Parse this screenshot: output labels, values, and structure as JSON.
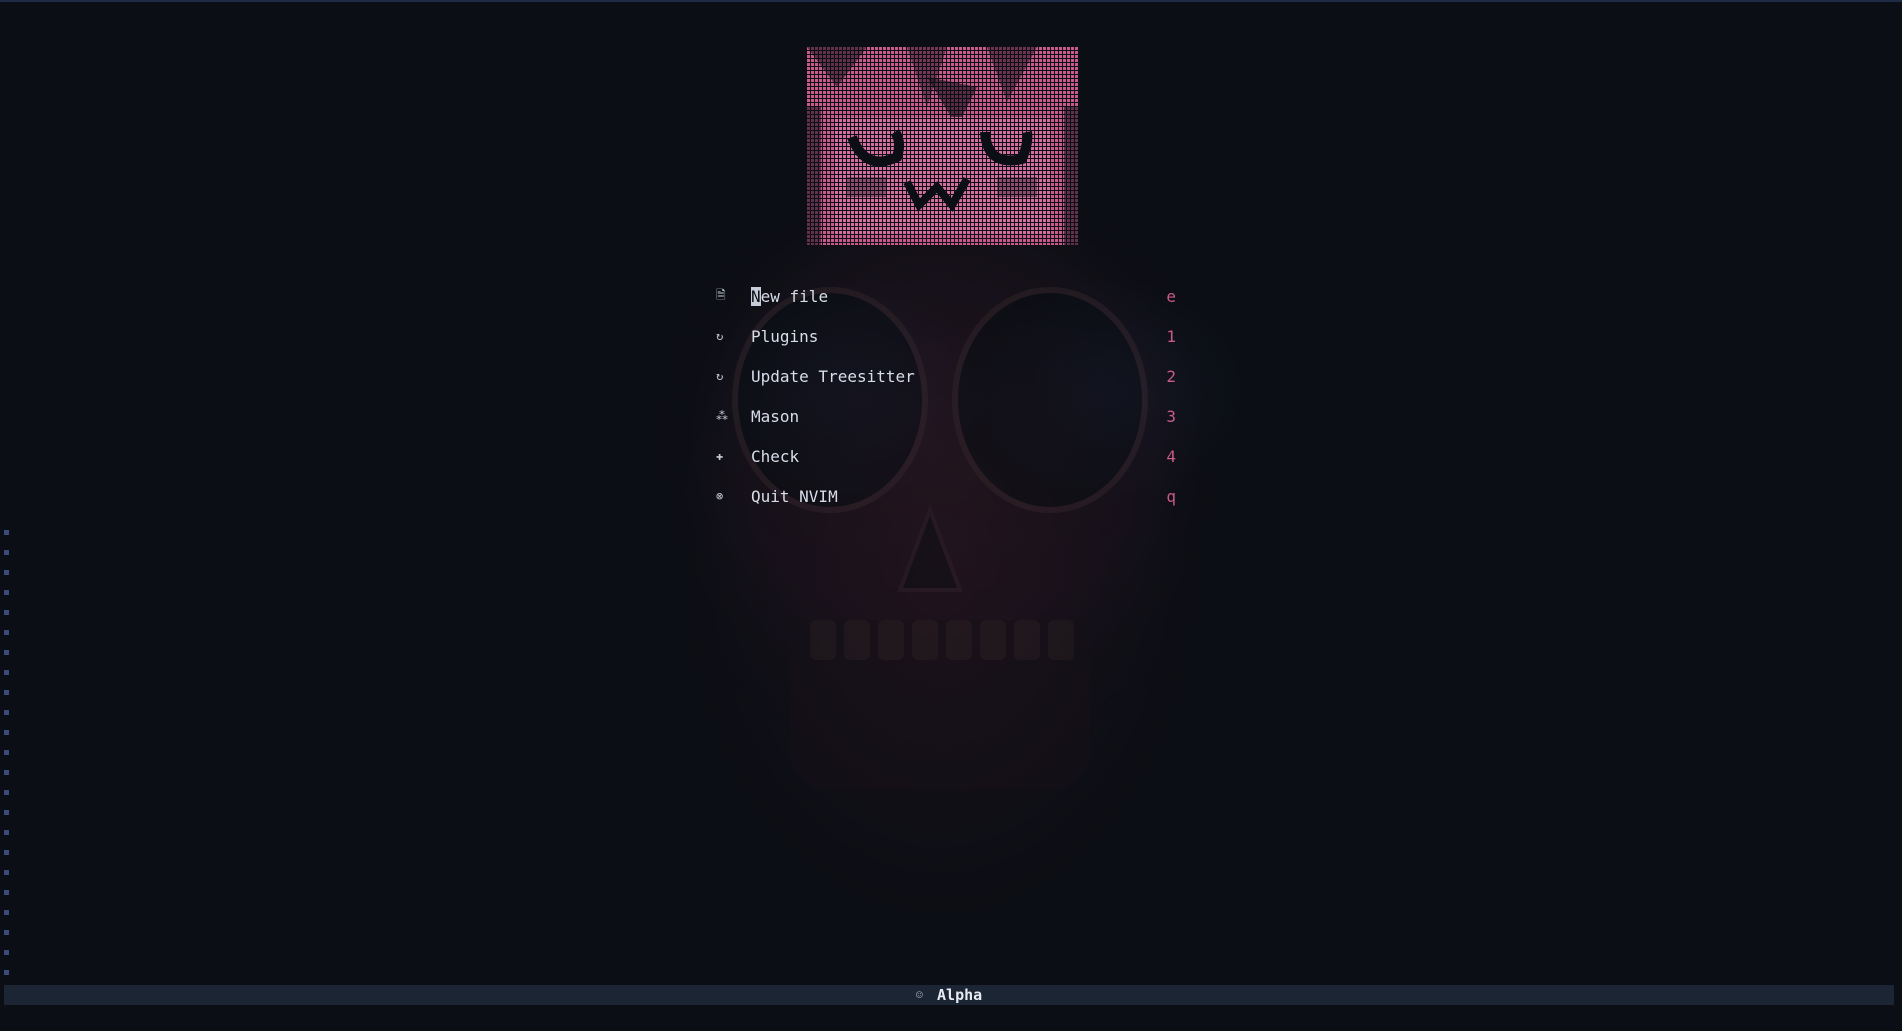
{
  "app": "nvim alpha dashboard",
  "colors": {
    "background": "#0b0e14",
    "accent_pink": "#c95a8c",
    "text": "#d8dee9",
    "statusline": "#1c2533"
  },
  "header_art": {
    "icon": "ascii-art-face-icon"
  },
  "menu": [
    {
      "icon": "file-icon",
      "glyph": "🗎",
      "label": "New file",
      "key": "e"
    },
    {
      "icon": "refresh-icon",
      "glyph": "↻",
      "label": "Plugins",
      "key": "1"
    },
    {
      "icon": "refresh-icon",
      "glyph": "↻",
      "label": "Update Treesitter",
      "key": "2"
    },
    {
      "icon": "mason-icon",
      "glyph": "⁂",
      "label": "Mason",
      "key": "3"
    },
    {
      "icon": "health-check-icon",
      "glyph": "✚",
      "label": "Check",
      "key": "4"
    },
    {
      "icon": "quit-icon",
      "glyph": "⊗",
      "label": "Quit NVIM",
      "key": "q"
    }
  ],
  "statusline": {
    "icon": "mode-icon",
    "title": "Alpha"
  }
}
